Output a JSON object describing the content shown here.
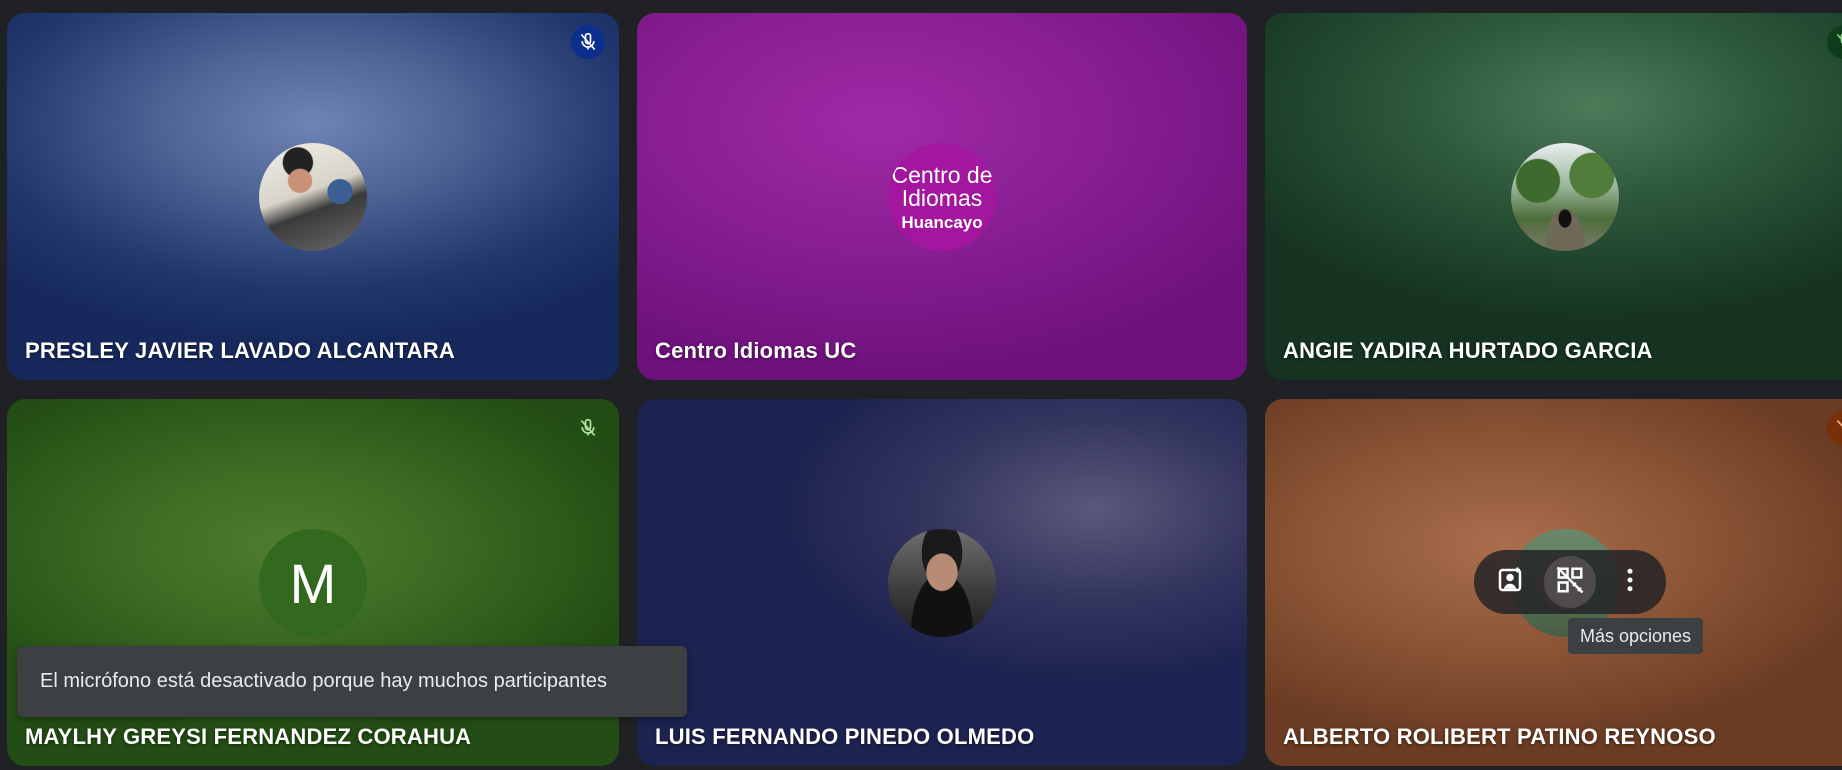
{
  "tiles": [
    {
      "name": "PRESLEY JAVIER LAVADO ALCANTARA",
      "avatar": "photo"
    },
    {
      "name": "Centro Idiomas UC",
      "avatar": "logo",
      "logo": {
        "line1": "Centro de",
        "line2": "Idiomas",
        "line3": "Huancayo"
      }
    },
    {
      "name": "ANGIE YADIRA HURTADO GARCIA",
      "avatar": "photo"
    },
    {
      "name": "MAYLHY GREYSI FERNANDEZ CORAHUA",
      "avatar": "initial",
      "initial": "M"
    },
    {
      "name": "LUIS FERNANDO PINEDO OLMEDO",
      "avatar": "photo"
    },
    {
      "name": "ALBERTO ROLIBERT PATINO REYNOSO",
      "avatar": "photo"
    }
  ],
  "toast": {
    "text": "El micrófono está desactivado porque hay muchos participantes"
  },
  "hover_controls": {
    "buttons": [
      "portrait-add-icon",
      "qr-code-off-icon",
      "more-vert-icon"
    ],
    "tooltip": "Más opciones"
  },
  "colors": {
    "mute_blue": "#0b2f8c",
    "mute_green": "#1f4f14",
    "centro_logo": "#a3179f",
    "initial_avatar": "#33691e"
  }
}
